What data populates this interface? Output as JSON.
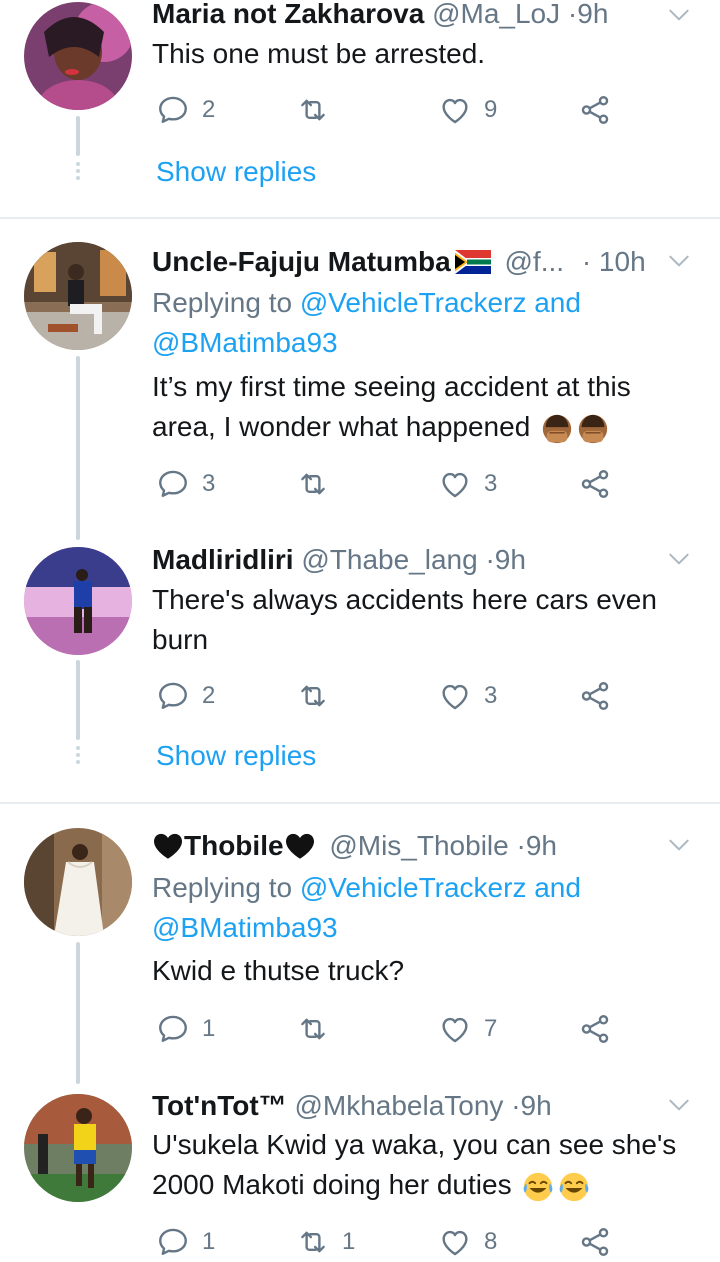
{
  "tweets": [
    {
      "name": "Maria not Zakharova",
      "handle": "@Ma_LoJ",
      "time": "9h",
      "text": "This one must be arrested.",
      "reply_count": "2",
      "retweet_count": "",
      "like_count": "9",
      "show_replies": "Show replies"
    },
    {
      "name": "Uncle-Fajuju Matumba",
      "handle": "@f...",
      "time": "10h",
      "replying_prefix": "Replying to",
      "replying_user1": "@VehicleTrackerz",
      "replying_and": "and",
      "replying_user2": "@BMatimba93",
      "text": "It’s my first time seeing accident at this area, I wonder what happened",
      "reply_count": "3",
      "retweet_count": "",
      "like_count": "3"
    },
    {
      "name": "Madliridliri",
      "handle": "@Thabe_lang",
      "time": "9h",
      "text": "There's always accidents here cars even burn",
      "reply_count": "2",
      "retweet_count": "",
      "like_count": "3",
      "show_replies": "Show replies"
    },
    {
      "name": "Thobile",
      "handle": "@Mis_Thobile",
      "time": "9h",
      "replying_prefix": "Replying to",
      "replying_user1": "@VehicleTrackerz",
      "replying_and": "and",
      "replying_user2": "@BMatimba93",
      "text": "Kwid e thutse truck?",
      "reply_count": "1",
      "retweet_count": "",
      "like_count": "7"
    },
    {
      "name": "Tot'nTot™",
      "handle": "@MkhabelaTony",
      "time": "9h",
      "text": "U'sukela Kwid ya waka, you can see she's 2000 Makoti doing her duties",
      "reply_count": "1",
      "retweet_count": "1",
      "like_count": "8"
    }
  ],
  "separator": "·",
  "icons": {
    "reply": "reply-icon",
    "retweet": "retweet-icon",
    "like": "like-icon",
    "share": "share-icon",
    "more": "chevron-down-icon"
  },
  "colors": {
    "link": "#1da1f2",
    "secondary": "#657786",
    "thread_line": "#ccd6dd",
    "divider": "#e6ecf0"
  }
}
